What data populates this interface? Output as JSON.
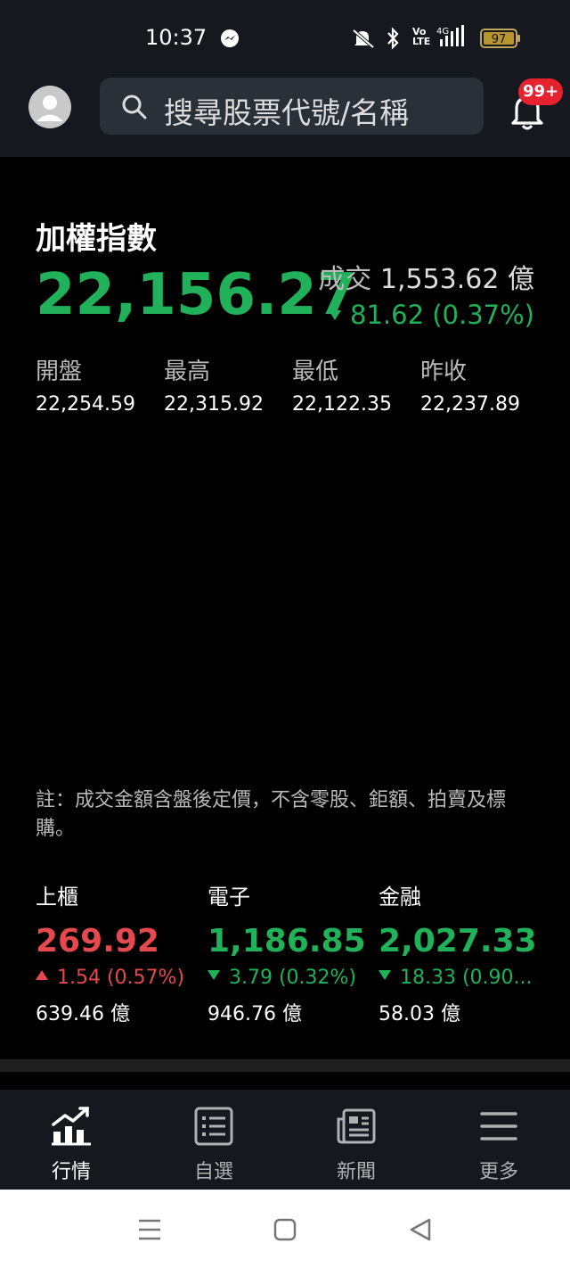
{
  "status_bar": {
    "time": "10:37",
    "battery": "97",
    "icons": [
      "messenger-icon",
      "mute-icon",
      "bluetooth-icon",
      "volte-icon",
      "signal-4g-icon",
      "battery-icon"
    ]
  },
  "header": {
    "search_placeholder": "搜尋股票代號/名稱",
    "notification_badge": "99+"
  },
  "main_index": {
    "name": "加權指數",
    "value": "22,156.27",
    "volume_label": "成交",
    "volume_value": "1,553.62 億",
    "change": "81.62 (0.37%)",
    "direction": "down",
    "color": "#20b15a",
    "stats": [
      {
        "label": "開盤",
        "value": "22,254.59"
      },
      {
        "label": "最高",
        "value": "22,315.92"
      },
      {
        "label": "最低",
        "value": "22,122.35"
      },
      {
        "label": "昨收",
        "value": "22,237.89"
      }
    ]
  },
  "note": "註：成交金額含盤後定價，不含零股、鉅額、拍賣及標購。",
  "sub_indices": [
    {
      "name": "上櫃",
      "value": "269.92",
      "change": "1.54 (0.57%)",
      "direction": "up",
      "amount": "639.46 億",
      "color": "#e5484d"
    },
    {
      "name": "電子",
      "value": "1,186.85",
      "change": "3.79 (0.32%)",
      "direction": "down",
      "amount": "946.76 億",
      "color": "#20b15a"
    },
    {
      "name": "金融",
      "value": "2,027.33",
      "change": "18.33 (0.90...",
      "direction": "down",
      "amount": "58.03 億",
      "color": "#20b15a"
    }
  ],
  "bottom_nav": [
    {
      "label": "行情",
      "icon": "market-chart-icon",
      "active": true
    },
    {
      "label": "自選",
      "icon": "watchlist-icon",
      "active": false
    },
    {
      "label": "新聞",
      "icon": "news-icon",
      "active": false
    },
    {
      "label": "更多",
      "icon": "menu-icon",
      "active": false
    }
  ]
}
